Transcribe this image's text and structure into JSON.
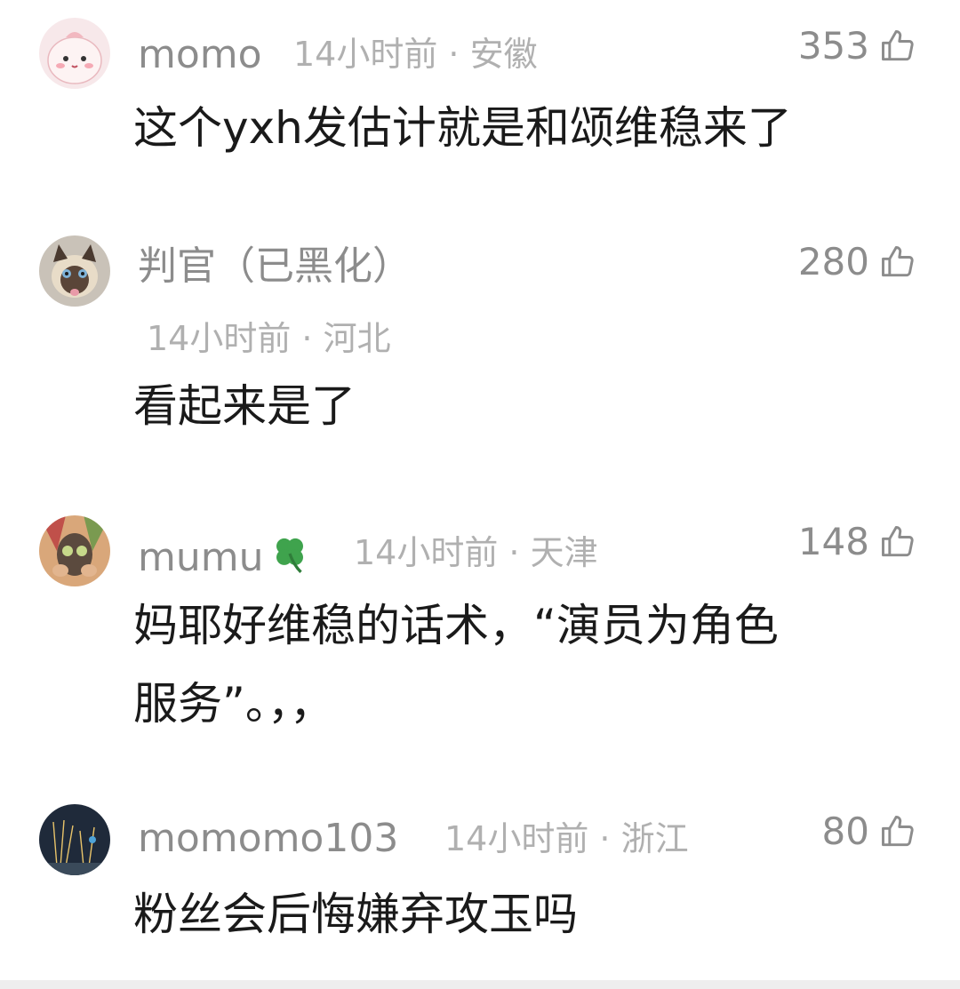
{
  "comments": [
    {
      "username": "momo",
      "meta": "14小时前 · 安徽",
      "likes": "353",
      "text": "这个yxh发估计就是和颂维稳来了",
      "avatar": "pink-cartoon-avatar"
    },
    {
      "username": "判官（已黑化）",
      "meta": "14小时前 · 河北",
      "likes": "280",
      "text": "看起来是了",
      "avatar": "siamese-cat-avatar"
    },
    {
      "username": "mumu",
      "meta": "14小时前 · 天津",
      "likes": "148",
      "text_line1": "妈耶好维稳的话术，“演员为角色",
      "text_line2": "服务”。，，",
      "avatar": "face-mask-avatar",
      "badge": "four-leaf-clover-icon"
    },
    {
      "username": "momomo103",
      "meta": "14小时前 · 浙江",
      "likes": "80",
      "text": "粉丝会后悔嫌弃攻玉吗",
      "avatar": "fireworks-avatar"
    }
  ],
  "colors": {
    "username": "#8c8c8c",
    "meta": "#b0b0b0",
    "content": "#1a1a1a",
    "background": "#ffffff"
  },
  "icons": {
    "like": "thumbs-up-icon"
  }
}
